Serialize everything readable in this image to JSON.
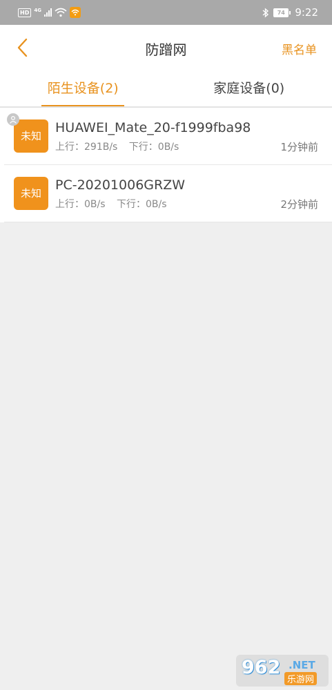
{
  "status_bar": {
    "hd": "HD",
    "network": "4G",
    "battery": "74",
    "time": "9:22"
  },
  "header": {
    "title": "防蹭网",
    "blacklist_label": "黑名单"
  },
  "tabs": [
    {
      "label": "陌生设备(2)",
      "active": true
    },
    {
      "label": "家庭设备(0)",
      "active": false
    }
  ],
  "devices": [
    {
      "avatar_label": "未知",
      "name": "HUAWEI_Mate_20-f1999fba98",
      "upload": "上行：291B/s",
      "download": "下行：0B/s",
      "time": "1分钟前",
      "online_badge": true
    },
    {
      "avatar_label": "未知",
      "name": "PC-20201006GRZW",
      "upload": "上行：0B/s",
      "download": "下行：0B/s",
      "time": "2分钟前",
      "online_badge": false
    }
  ],
  "watermark": {
    "number": "962",
    "domain": ".NET",
    "text": "乐游网"
  },
  "colors": {
    "accent": "#e8921e",
    "avatar": "#f0921c",
    "status_bar": "#a9a9a9",
    "background": "#efefef"
  }
}
